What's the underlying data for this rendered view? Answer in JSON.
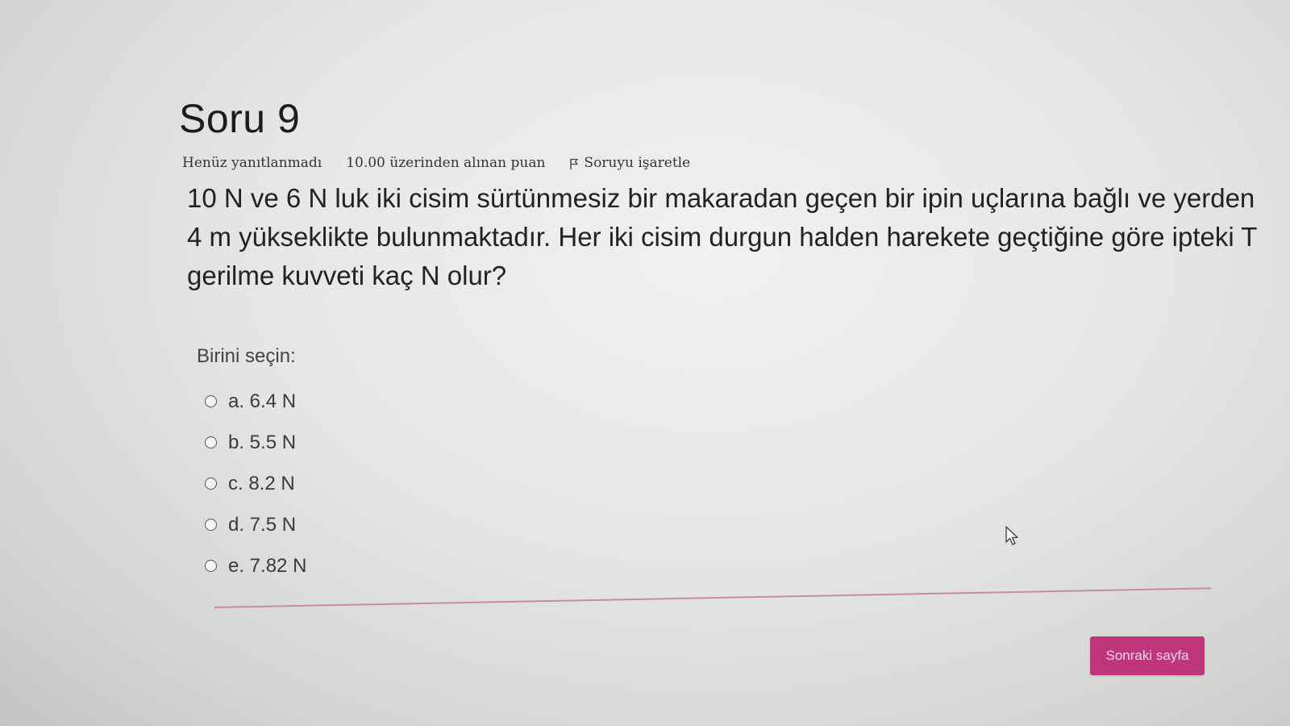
{
  "question": {
    "title": "Soru 9",
    "state": "Henüz yanıtlanmadı",
    "grade": "10.00 üzerinden alınan puan",
    "flag_label": "Soruyu işaretle",
    "text": "10 N ve 6 N luk iki cisim sürtünmesiz bir makaradan geçen bir ipin uçlarına bağlı ve yerden 4 m yükseklikte bulunmaktadır. Her iki cisim durgun halden harekete geçtiğine göre ipteki T gerilme kuvveti kaç N olur?",
    "prompt": "Birini seçin:",
    "options": [
      {
        "label": "a. 6.4 N"
      },
      {
        "label": "b. 5.5 N"
      },
      {
        "label": "c. 8.2 N"
      },
      {
        "label": "d. 7.5 N"
      },
      {
        "label": "e. 7.82 N"
      }
    ]
  },
  "navigation": {
    "next_label": "Sonraki sayfa"
  },
  "icons": {
    "flag": "flag-icon",
    "radio": "radio-icon",
    "cursor": "mouse-cursor-icon"
  },
  "colors": {
    "accent": "#c0357a",
    "divider": "#c98aa4",
    "text": "#222222"
  }
}
